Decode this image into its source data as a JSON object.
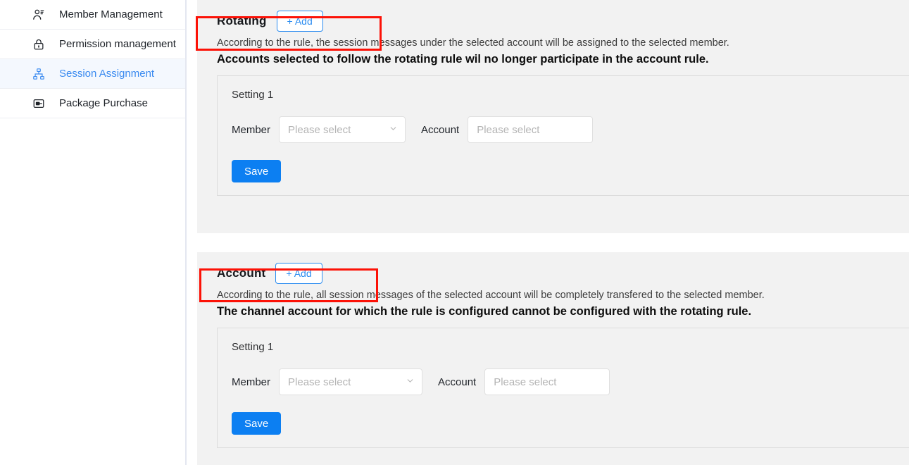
{
  "sidebar": {
    "items": [
      {
        "label": "Member Management",
        "icon": "user-list-icon",
        "active": false
      },
      {
        "label": "Permission management",
        "icon": "lock-icon",
        "active": false
      },
      {
        "label": "Session Assignment",
        "icon": "sitemap-icon",
        "active": true
      },
      {
        "label": "Package Purchase",
        "icon": "package-card-icon",
        "active": false
      }
    ]
  },
  "sections": [
    {
      "title": "Rotating",
      "add_label": "+ Add",
      "description": "According to the rule, the session messages under the selected account will be assigned to the selected member.",
      "warning": "Accounts selected to follow the rotating rule wil no longer participate in the account rule.",
      "setting": {
        "title": "Setting 1",
        "member_label": "Member",
        "member_placeholder": "Please select",
        "account_label": "Account",
        "account_placeholder": "Please select",
        "save_label": "Save"
      }
    },
    {
      "title": "Account",
      "add_label": "+ Add",
      "description": "According to the rule, all session messages of the selected account will be completely transfered to the selected member.",
      "warning": "The channel account for which the rule is configured cannot be configured with the rotating rule.",
      "setting": {
        "title": "Setting 1",
        "member_label": "Member",
        "member_placeholder": "Please select",
        "account_label": "Account",
        "account_placeholder": "Please select",
        "save_label": "Save"
      }
    }
  ],
  "colors": {
    "accent_blue": "#0c7ff2",
    "link_blue": "#3a8af0",
    "annotation_red": "#fc1207",
    "panel_gray": "#f2f2f2"
  }
}
